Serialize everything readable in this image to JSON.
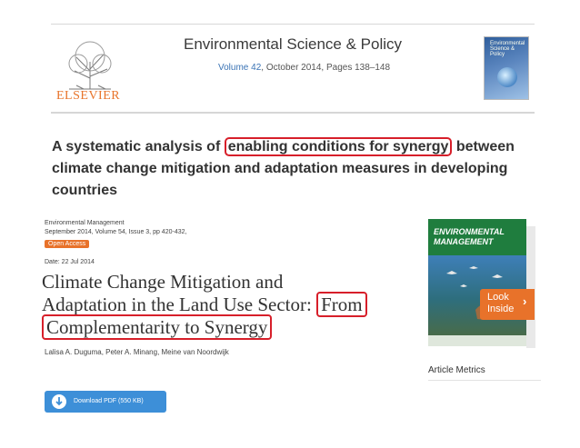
{
  "banner": {
    "publisher": "ELSEVIER",
    "journal": "Environmental Science & Policy",
    "volume_link": "Volume 42",
    "issue_rest": ", October 2014, Pages 138–148",
    "cover_text": "Environmental Science & Policy"
  },
  "article": {
    "title_line1_pre": "A systematic analysis of ",
    "title_line1_highlight": "enabling conditions for synergy",
    "title_line1_post": " between",
    "title_line2": "climate change mitigation and adaptation measures in developing",
    "title_line3": "countries"
  },
  "springer": {
    "journal": "Environmental Management",
    "issue": "September 2014, Volume 54, Issue 3, pp 420-432,",
    "open_access": "Open Access",
    "date": "Date: 22 Jul 2014",
    "title_line1": "Climate Change Mitigation and",
    "title_line2_pre": "Adaptation in the Land Use Sector: ",
    "title_line2_highlight": "From",
    "title_line3_highlight": "Complementarity to Synergy",
    "authors": "Lalisa A. Duguma, Peter A. Minang, Meine van Noordwijk",
    "download_label": "Download PDF (550 KB)",
    "cover_brand_1": "ENVIRONMENTAL",
    "cover_brand_2": "MANAGEMENT",
    "look_inside": "Look Inside",
    "look_inside_line1": "Look",
    "look_inside_line2": "Inside",
    "metrics": "Article Metrics"
  },
  "colors": {
    "highlight_box": "#d71f2a",
    "accent_orange": "#e8722a",
    "download_blue": "#3d8fd8",
    "elsevier_orange": "#e8742b"
  }
}
